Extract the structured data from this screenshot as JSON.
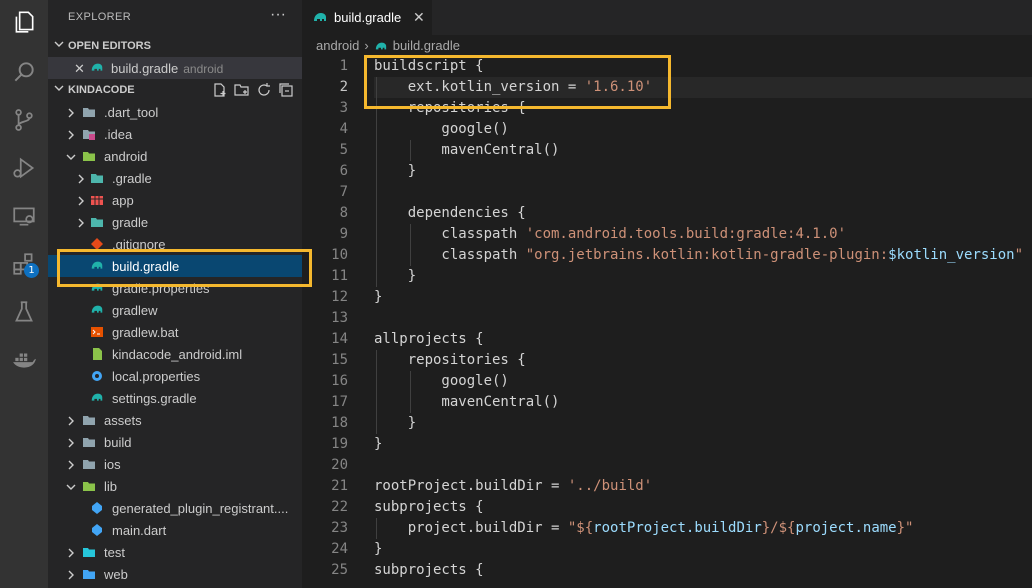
{
  "sidebar": {
    "title": "EXPLORER",
    "more_label": "···",
    "open_editors": {
      "label": "OPEN EDITORS",
      "items": [
        {
          "close_label": "✕",
          "name": "build.gradle",
          "desc": "android"
        }
      ]
    },
    "project": {
      "label": "KINDACODE"
    },
    "tree": [
      {
        "name": ".dart_tool",
        "icon": "folder-icon",
        "expanded": false
      },
      {
        "name": ".idea",
        "icon": "idea-folder-icon",
        "expanded": false
      },
      {
        "name": "android",
        "icon": "android-folder-icon",
        "expanded": true
      },
      {
        "name": ".gradle",
        "icon": "gradle-folder-icon",
        "expanded": false
      },
      {
        "name": "app",
        "icon": "app-folder-icon",
        "expanded": false
      },
      {
        "name": "gradle",
        "icon": "gradle-folder-icon",
        "expanded": false
      },
      {
        "name": ".gitignore",
        "icon": "git-icon"
      },
      {
        "name": "build.gradle",
        "icon": "gradle-elephant-icon",
        "selected": true
      },
      {
        "name": "gradle.properties",
        "icon": "gradle-elephant-icon"
      },
      {
        "name": "gradlew",
        "icon": "gradle-elephant-icon"
      },
      {
        "name": "gradlew.bat",
        "icon": "bat-file-icon"
      },
      {
        "name": "kindacode_android.iml",
        "icon": "iml-file-icon"
      },
      {
        "name": "local.properties",
        "icon": "gear-icon"
      },
      {
        "name": "settings.gradle",
        "icon": "gradle-elephant-icon"
      },
      {
        "name": "assets",
        "icon": "folder-icon",
        "expanded": false
      },
      {
        "name": "build",
        "icon": "folder-icon",
        "expanded": false
      },
      {
        "name": "ios",
        "icon": "ios-folder-icon",
        "expanded": false
      },
      {
        "name": "lib",
        "icon": "lib-folder-icon",
        "expanded": true
      },
      {
        "name": "generated_plugin_registrant....",
        "icon": "dart-file-icon"
      },
      {
        "name": "main.dart",
        "icon": "dart-file-icon"
      },
      {
        "name": "test",
        "icon": "test-folder-icon",
        "expanded": false
      },
      {
        "name": "web",
        "icon": "web-folder-icon",
        "expanded": false
      }
    ]
  },
  "tab": {
    "name": "build.gradle",
    "close_label": "✕"
  },
  "breadcrumb": {
    "folder": "android",
    "sep": "›",
    "file": "build.gradle"
  },
  "editor": {
    "active_line": 2,
    "lines": [
      "1",
      "2",
      "3",
      "4",
      "5",
      "6",
      "7",
      "8",
      "9",
      "10",
      "11",
      "12",
      "13",
      "14",
      "15",
      "16",
      "17",
      "18",
      "19",
      "20",
      "21",
      "22",
      "23",
      "24",
      "25"
    ],
    "code": {
      "l1": "buildscript {",
      "l2_a": "    ext.kotlin_version = ",
      "l2_b": "'1.6.10'",
      "l3": "    repositories {",
      "l4": "        google()",
      "l5": "        mavenCentral()",
      "l6": "    }",
      "l7": "",
      "l8": "    dependencies {",
      "l9_a": "        classpath ",
      "l9_b": "'com.android.tools.build:gradle:4.1.0'",
      "l10_a": "        classpath ",
      "l10_b": "\"org.jetbrains.kotlin:kotlin-gradle-plugin:",
      "l10_c": "$kotlin_version",
      "l10_d": "\"",
      "l11": "    }",
      "l12": "}",
      "l13": "",
      "l14": "allprojects {",
      "l15": "    repositories {",
      "l16": "        google()",
      "l17": "        mavenCentral()",
      "l18": "    }",
      "l19": "}",
      "l20": "",
      "l21_a": "rootProject.buildDir = ",
      "l21_b": "'../build'",
      "l22": "subprojects {",
      "l23_a": "    project.buildDir = ",
      "l23_b": "\"${",
      "l23_c": "rootProject.buildDir",
      "l23_d": "}/${",
      "l23_e": "project.name",
      "l23_f": "}\"",
      "l24": "}",
      "l25": "subprojects {"
    }
  },
  "activity_bar": {
    "icons": [
      "files-icon",
      "search-icon",
      "source-control-icon",
      "run-debug-icon",
      "remote-explorer-icon",
      "extensions-icon",
      "testing-icon",
      "docker-icon"
    ],
    "extensions_badge": "1"
  },
  "colors": {
    "accent_highlight": "#f5b82e",
    "selection": "#094771"
  }
}
